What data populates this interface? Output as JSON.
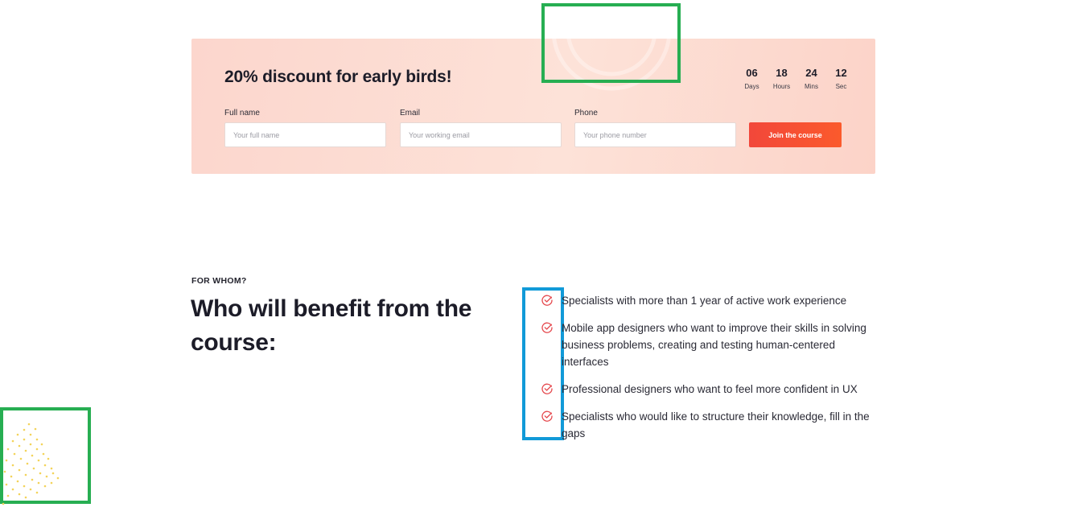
{
  "promo": {
    "title": "20% discount for early birds!",
    "countdown": [
      {
        "value": "06",
        "label": "Days"
      },
      {
        "value": "18",
        "label": "Hours"
      },
      {
        "value": "24",
        "label": "Mins"
      },
      {
        "value": "12",
        "label": "Sec"
      }
    ],
    "fields": {
      "full_name": {
        "label": "Full name",
        "placeholder": "Your full name"
      },
      "email": {
        "label": "Email",
        "placeholder": "Your working email"
      },
      "phone": {
        "label": "Phone",
        "placeholder": "Your phone number"
      }
    },
    "join_label": "Join the course"
  },
  "for_whom": {
    "eyebrow": "FOR WHOM?",
    "title": "Who will benefit from the course:",
    "items": [
      "Specialists with more than 1 year of active work experience",
      "Mobile app designers who want to improve their skills in solving business problems, creating and testing human-centered interfaces",
      "Professional designers who want to feel more confident in UX",
      "Specialists who would like to structure their knowledge, fill in the gaps"
    ]
  },
  "colors": {
    "accent": "#f2473a",
    "card_bg": "#fcd6cd",
    "check": "#e5484d",
    "highlight_green": "#27ae52",
    "highlight_blue": "#119ad8",
    "dots": "#f3d35a"
  },
  "icons": {
    "benefit_marker": "check-circle-icon"
  }
}
